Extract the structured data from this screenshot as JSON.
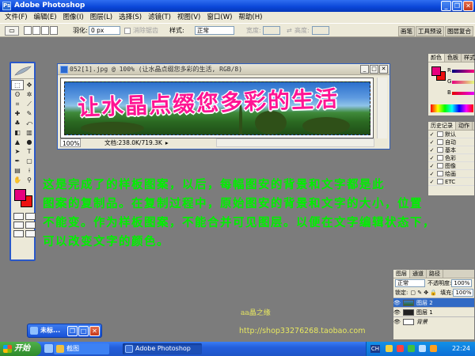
{
  "window": {
    "title": "Adobe Photoshop",
    "app_icon_glyph": "Ps"
  },
  "menu": [
    "文件(F)",
    "编辑(E)",
    "图像(I)",
    "图层(L)",
    "选择(S)",
    "滤镜(T)",
    "视图(V)",
    "窗口(W)",
    "帮助(H)"
  ],
  "options_bar": {
    "feather_label": "羽化:",
    "feather_value": "0 px",
    "antialias_label": "消除锯齿",
    "style_label": "样式:",
    "style_value": "正常",
    "width_label": "宽度:",
    "height_label": "高度:",
    "well_tabs": [
      "画笔",
      "工具预设",
      "图层复合"
    ]
  },
  "document": {
    "title": "052[1].jpg @ 100% (让水晶点缀您多彩的生活, RGB/8)",
    "banner_text": "让水晶点缀您多彩的生活",
    "zoom": "100%",
    "doc_size": "文档:238.0K/719.3K"
  },
  "caption": [
    "这是完成了的样板图案，以后，每幅图安的背景和文字都是此",
    "图案的复制品。在复制过程中，原始图安的背景和文字的大小，位置",
    "不能变。作为样板图案，不能合并可见图层。以便在文字编辑状态下，",
    "可以改变文字的颜色。"
  ],
  "color_panel": {
    "tabs": [
      "颜色",
      "色板",
      "样式"
    ],
    "channels": [
      "R",
      "G",
      "B"
    ]
  },
  "history_panel": {
    "tabs": [
      "历史记录",
      "动作"
    ],
    "items": [
      "默认",
      "自动",
      "基本",
      "色彩",
      "图像",
      "绘画",
      "ETC"
    ]
  },
  "layers_panel": {
    "tabs": [
      "图层",
      "通道",
      "路径"
    ],
    "blend_mode": "正常",
    "opacity_label": "不透明度:",
    "opacity_value": "100%",
    "lock_label": "锁定:",
    "fill_label": "填充:",
    "fill_value": "100%",
    "layers": [
      "图层 2",
      "图层 1",
      "背景"
    ]
  },
  "footer": {
    "shop_name": "aa晶之缘",
    "shop_url": "http://shop33276268.taobao.com"
  },
  "mini_palette": {
    "label": "未标..."
  },
  "taskbar": {
    "start_label": "开始",
    "tasks": [
      "截图",
      "Adobe Photoshop"
    ],
    "lang": "CH",
    "clock": "22:24"
  },
  "colors": {
    "foreground": "#e6007e",
    "background": "#ee1010",
    "caption_text": "#00f000",
    "desktop": "#7c7c7c"
  }
}
